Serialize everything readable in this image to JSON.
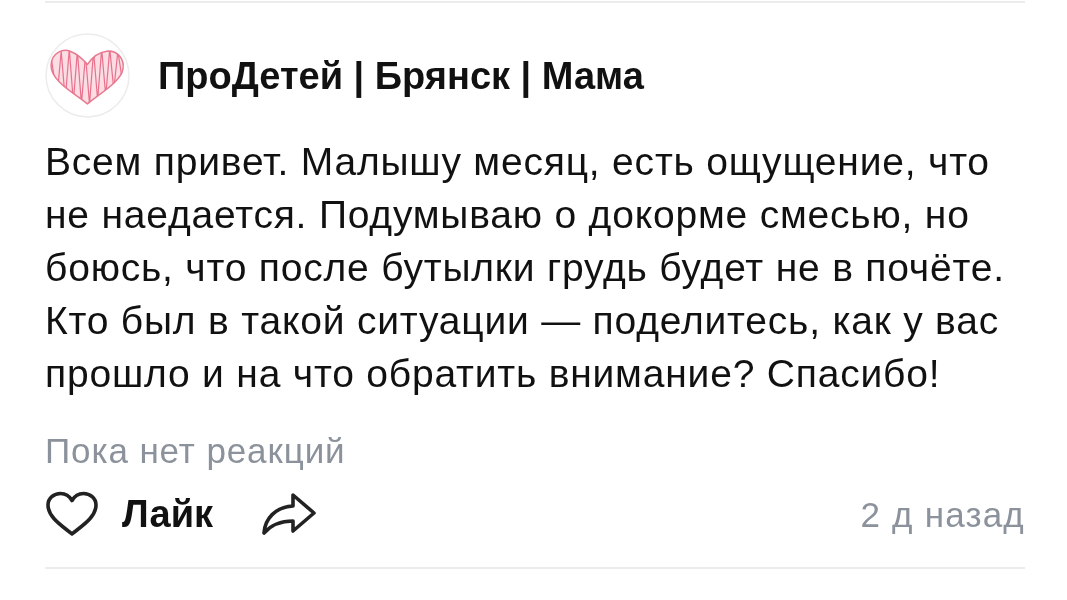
{
  "post": {
    "author": "ПроДетей | Брянск | Мама",
    "text": "Всем привет. Малышу месяц, есть ощущение, что не наедается. Подумываю о докорме смесью, но боюсь, что после бутылки грудь будет не в почёте. Кто был в такой ситуации — поделитесь, как у вас прошло и на что обратить внимание? Спасибо!",
    "reactions_summary": "Пока нет реакций",
    "like": {
      "label": "Лайк",
      "liked": false
    },
    "time": "2 д назад"
  }
}
